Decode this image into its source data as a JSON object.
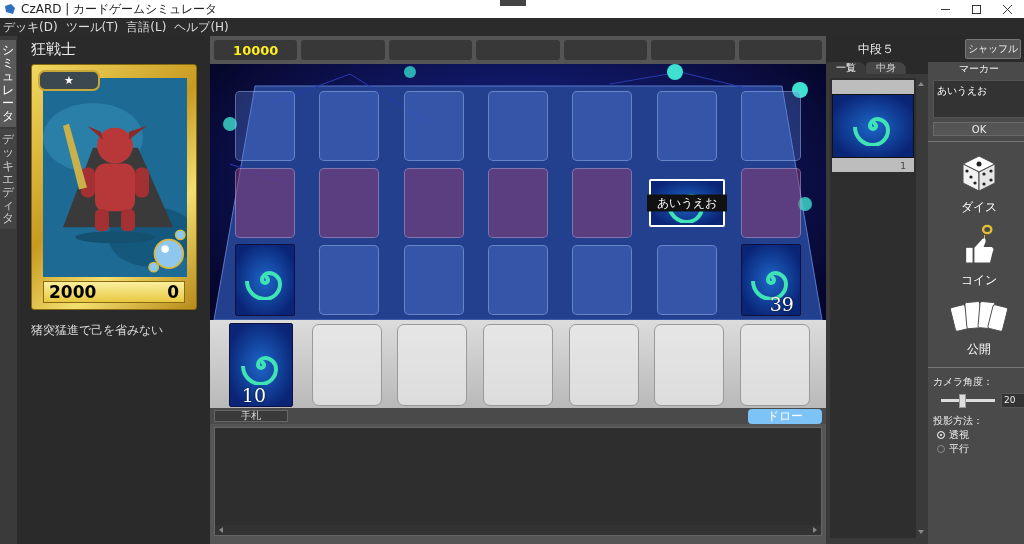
{
  "window": {
    "title": "CzARD | カードゲームシミュレータ"
  },
  "menu": [
    {
      "label": "デッキ(D)"
    },
    {
      "label": "ツール(T)"
    },
    {
      "label": "言語(L)"
    },
    {
      "label": "ヘルプ(H)"
    }
  ],
  "side_tabs": [
    {
      "label": "シミュレータ",
      "selected": true
    },
    {
      "label": "デッキエディタ",
      "selected": false
    }
  ],
  "card_detail": {
    "name": "狂戦士",
    "rank": "★",
    "attack": "2000",
    "defense": "0",
    "description": "猪突猛進で己を省みない"
  },
  "life": "10000",
  "board": {
    "rows": [
      {
        "kind": "blue",
        "slots": [
          {
            "selected": false
          },
          {
            "selected": false
          },
          {
            "selected": false
          },
          {
            "selected": false
          },
          {
            "selected": false
          },
          {
            "selected": false
          },
          {
            "selected": false
          }
        ]
      },
      {
        "kind": "red",
        "slots": [
          {
            "selected": false
          },
          {
            "selected": false
          },
          {
            "selected": false
          },
          {
            "selected": false
          },
          {
            "selected": false
          },
          {
            "selected": true,
            "card": {
              "sideways": true,
              "label": "あいうえお"
            }
          },
          {
            "selected": false
          }
        ]
      },
      {
        "kind": "blue",
        "slots": [
          {
            "selected": false,
            "card": {
              "sideways": false
            }
          },
          {
            "selected": false
          },
          {
            "selected": false
          },
          {
            "selected": false
          },
          {
            "selected": false
          },
          {
            "selected": false
          },
          {
            "selected": false,
            "card": {
              "sideways": false,
              "count": "39"
            }
          }
        ]
      },
      {
        "kind": "grey",
        "slots": [
          {
            "selected": false,
            "card": {
              "sideways": false,
              "count": "10"
            }
          },
          {
            "selected": false
          },
          {
            "selected": false
          },
          {
            "selected": false
          },
          {
            "selected": false
          },
          {
            "selected": false
          },
          {
            "selected": false
          }
        ]
      }
    ]
  },
  "hand": {
    "tab": "手札",
    "draw_button": "ドロー"
  },
  "zone_panel": {
    "title": "中段５",
    "shuffle_button": "シャッフル",
    "tabs": [
      {
        "label": "一覧",
        "selected": true
      },
      {
        "label": "中身",
        "selected": false
      }
    ],
    "cards": [
      {
        "count": "1"
      }
    ]
  },
  "tools": {
    "marker_label": "マーカー",
    "marker_text": "あいうえお",
    "ok_button": "OK",
    "actions": [
      {
        "kind": "dice",
        "label": "ダイス"
      },
      {
        "kind": "coin",
        "label": "コイン"
      },
      {
        "kind": "reveal",
        "label": "公開"
      }
    ],
    "camera": {
      "label": "カメラ角度：",
      "level": 0.38,
      "value": "20"
    },
    "projection": {
      "label": "投影方法：",
      "options": [
        {
          "label": "透視",
          "selected": true
        },
        {
          "label": "平行",
          "selected": false
        }
      ]
    }
  }
}
